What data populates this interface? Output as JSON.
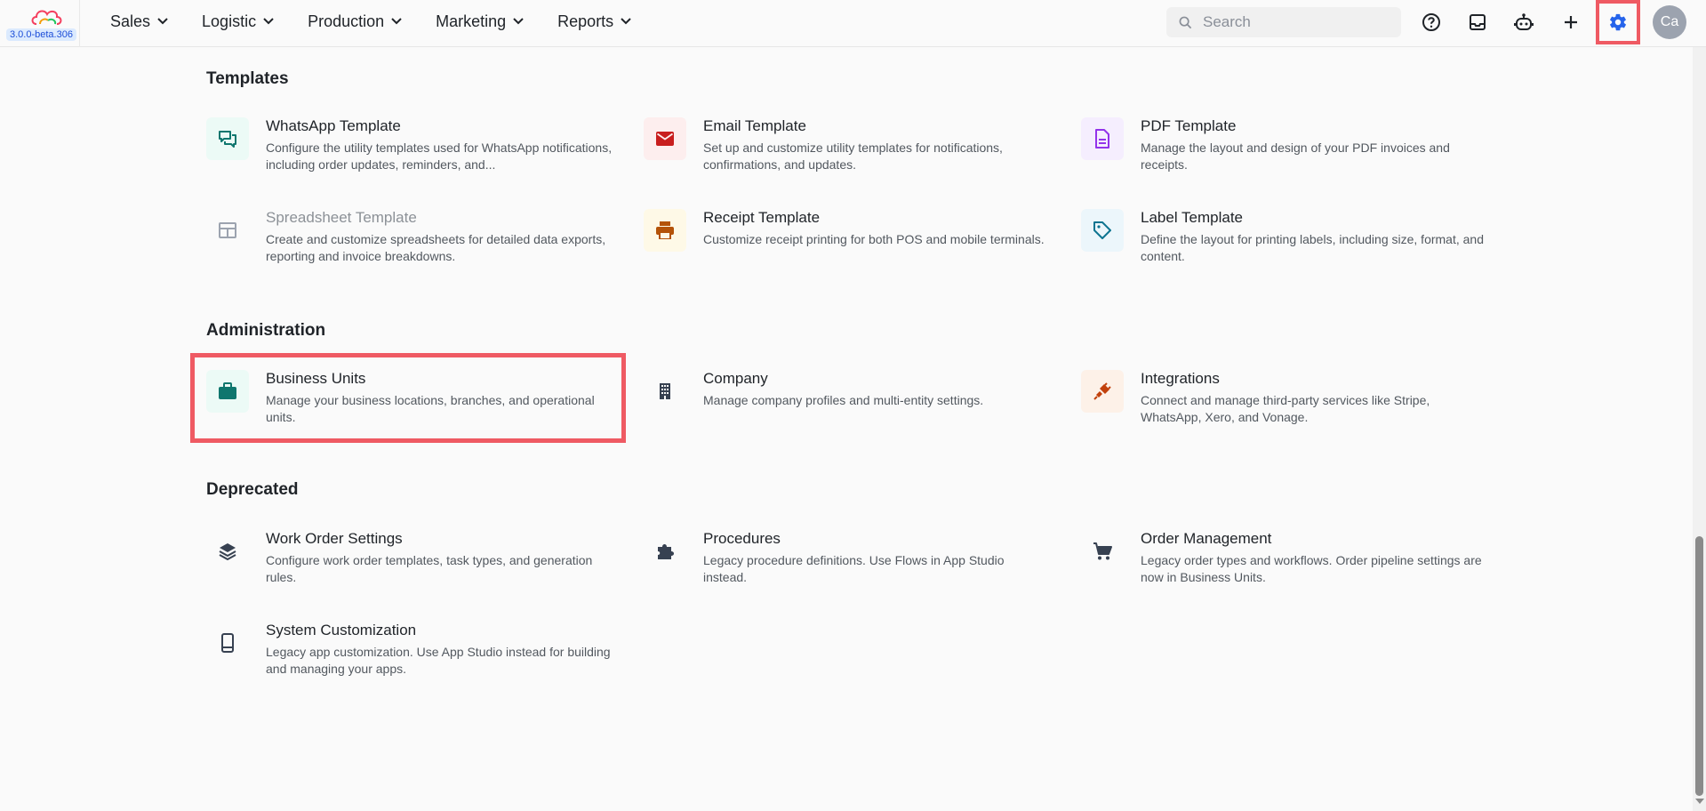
{
  "app": {
    "version": "3.0.0-beta.306",
    "colors": {
      "accent": "#2563eb",
      "highlight": "#ef5a63",
      "background": "#fafafa"
    }
  },
  "nav": {
    "items": [
      {
        "label": "Sales"
      },
      {
        "label": "Logistic"
      },
      {
        "label": "Production"
      },
      {
        "label": "Marketing"
      },
      {
        "label": "Reports"
      }
    ]
  },
  "search": {
    "placeholder": "Search"
  },
  "toolbar": {
    "icons": [
      "help-icon",
      "inbox-icon",
      "robot-icon",
      "plus-icon",
      "gear-icon"
    ]
  },
  "user": {
    "initials": "Ca"
  },
  "sections": {
    "templates": {
      "title": "Templates",
      "cards": [
        {
          "title": "WhatsApp Template",
          "desc": "Configure the utility templates used for WhatsApp notifications, including order updates, reminders, and...",
          "icon": "chat-icon"
        },
        {
          "title": "Email Template",
          "desc": "Set up and customize utility templates for notifications, confirmations, and updates.",
          "icon": "mail-icon"
        },
        {
          "title": "PDF Template",
          "desc": "Manage the layout and design of your PDF invoices and receipts.",
          "icon": "document-icon"
        },
        {
          "title": "Spreadsheet Template",
          "desc": "Create and customize spreadsheets for detailed data exports, reporting and invoice breakdowns.",
          "icon": "table-icon"
        },
        {
          "title": "Receipt Template",
          "desc": "Customize receipt printing for both POS and mobile terminals.",
          "icon": "printer-icon"
        },
        {
          "title": "Label Template",
          "desc": "Define the layout for printing labels, including size, format, and content.",
          "icon": "tag-icon"
        }
      ]
    },
    "administration": {
      "title": "Administration",
      "cards": [
        {
          "title": "Business Units",
          "desc": "Manage your business locations, branches, and operational units.",
          "icon": "briefcase-icon"
        },
        {
          "title": "Company",
          "desc": "Manage company profiles and multi-entity settings.",
          "icon": "building-icon"
        },
        {
          "title": "Integrations",
          "desc": "Connect and manage third-party services like Stripe, WhatsApp, Xero, and Vonage.",
          "icon": "plug-icon"
        }
      ]
    },
    "deprecated": {
      "title": "Deprecated",
      "cards": [
        {
          "title": "Work Order Settings",
          "desc": "Configure work order templates, task types, and generation rules.",
          "icon": "layers-icon"
        },
        {
          "title": "Procedures",
          "desc": "Legacy procedure definitions. Use Flows in App Studio instead.",
          "icon": "puzzle-icon"
        },
        {
          "title": "Order Management",
          "desc": "Legacy order types and workflows. Order pipeline settings are now in Business Units.",
          "icon": "cart-icon"
        },
        {
          "title": "System Customization",
          "desc": "Legacy app customization. Use App Studio instead for building and managing your apps.",
          "icon": "phone-icon"
        }
      ]
    }
  }
}
